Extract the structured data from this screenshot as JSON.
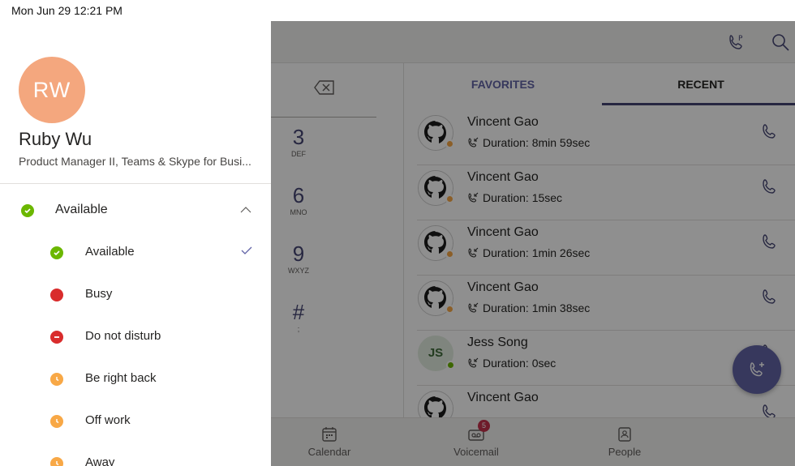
{
  "status_bar": {
    "time": "Mon Jun 29  12:21 PM"
  },
  "profile": {
    "initials": "RW",
    "name": "Ruby Wu",
    "title": "Product Manager II, Teams & Skype for Busi...",
    "avatar_color": "#f4a77e"
  },
  "presence": {
    "current": "Available",
    "options": [
      {
        "label": "Available",
        "color": "#6bb700",
        "icon": "check"
      },
      {
        "label": "Busy",
        "color": "#d92c2c",
        "icon": "none"
      },
      {
        "label": "Do not disturb",
        "color": "#d92c2c",
        "icon": "minus"
      },
      {
        "label": "Be right back",
        "color": "#f8a846",
        "icon": "clock"
      },
      {
        "label": "Off work",
        "color": "#f8a846",
        "icon": "clock"
      },
      {
        "label": "Away",
        "color": "#f8a846",
        "icon": "clock"
      }
    ]
  },
  "dialpad": {
    "keys": [
      {
        "num": "3",
        "letters": "DEF"
      },
      {
        "num": "6",
        "letters": "MNO"
      },
      {
        "num": "9",
        "letters": "WXYZ"
      },
      {
        "num": "#",
        "letters": ";"
      }
    ]
  },
  "tabs": {
    "favorites": "FAVORITES",
    "recent": "RECENT"
  },
  "recent": [
    {
      "name": "Vincent Gao",
      "duration": "Duration: 8min 59sec",
      "avatar": "github",
      "presence_color": "#f8a846"
    },
    {
      "name": "Vincent Gao",
      "duration": "Duration: 15sec",
      "avatar": "github",
      "presence_color": "#f8a846"
    },
    {
      "name": "Vincent Gao",
      "duration": "Duration: 1min 26sec",
      "avatar": "github",
      "presence_color": "#f8a846"
    },
    {
      "name": "Vincent Gao",
      "duration": "Duration: 1min 38sec",
      "avatar": "github",
      "presence_color": "#f8a846"
    },
    {
      "name": "Jess Song",
      "duration": "Duration: 0sec",
      "avatar": "JS",
      "presence_color": "#6bb700"
    },
    {
      "name": "Vincent Gao",
      "duration": "",
      "avatar": "github",
      "presence_color": "#f8a846"
    }
  ],
  "bottom_nav": {
    "calendar": "Calendar",
    "voicemail": "Voicemail",
    "voicemail_badge": "5",
    "people": "People"
  },
  "colors": {
    "accent": "#6264a7",
    "overlay": "rgba(0,0,0,0.44)"
  }
}
